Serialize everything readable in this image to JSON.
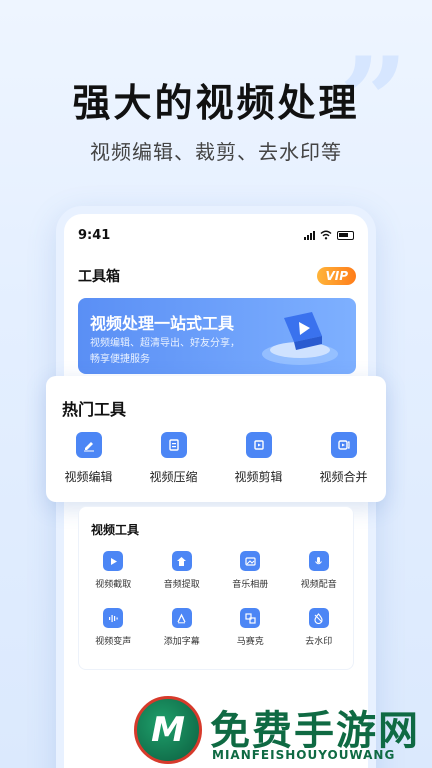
{
  "headline": "强大的视频处理",
  "subline": "视频编辑、裁剪、去水印等",
  "phone": {
    "time": "9:41",
    "app_title": "工具箱",
    "vip": "VIP",
    "banner": {
      "title": "视频处理一站式工具",
      "desc": "视频编辑、超清导出、好友分享，畅享便捷服务"
    }
  },
  "hot_tools": {
    "title": "热门工具",
    "items": [
      {
        "label": "视频编辑",
        "icon": "edit-icon"
      },
      {
        "label": "视频压缩",
        "icon": "compress-icon"
      },
      {
        "label": "视频剪辑",
        "icon": "crop-icon"
      },
      {
        "label": "视频合并",
        "icon": "merge-icon"
      }
    ]
  },
  "video_tools": {
    "title": "视频工具",
    "items": [
      {
        "label": "视频截取",
        "icon": "clip-icon"
      },
      {
        "label": "音频提取",
        "icon": "extract-icon"
      },
      {
        "label": "音乐相册",
        "icon": "album-icon"
      },
      {
        "label": "视频配音",
        "icon": "mic-icon"
      },
      {
        "label": "视频变声",
        "icon": "voice-icon"
      },
      {
        "label": "添加字幕",
        "icon": "subtitle-icon"
      },
      {
        "label": "马赛克",
        "icon": "mosaic-icon"
      },
      {
        "label": "去水印",
        "icon": "watermark-icon"
      }
    ]
  },
  "watermark": {
    "logo_letter": "M",
    "title": "免费手游网",
    "subtitle": "MIANFEISHOUYOUWANG"
  },
  "colors": {
    "accent": "#4c86f5",
    "vip": "#ff8a1f",
    "watermark_green": "#0f6a43"
  }
}
